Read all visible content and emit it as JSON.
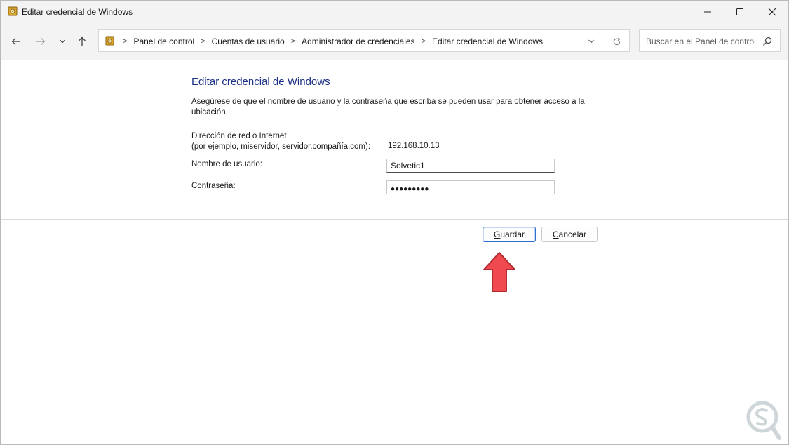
{
  "window": {
    "title": "Editar credencial de Windows",
    "icon": "control-panel-icon"
  },
  "navigation": {
    "breadcrumbs": [
      "Panel de control",
      "Cuentas de usuario",
      "Administrador de credenciales",
      "Editar credencial de Windows"
    ],
    "search_placeholder": "Buscar en el Panel de control"
  },
  "form": {
    "heading": "Editar credencial de Windows",
    "description": "Asegúrese de que el nombre de usuario y la contraseña que escriba se pueden usar para obtener acceso a la ubicación.",
    "address_label_line1": "Dirección de red o Internet",
    "address_label_line2": "(por ejemplo, miservidor, servidor.compañía.com):",
    "address_value": "192.168.10.13",
    "username_label": "Nombre de usuario:",
    "username_value": "Solvetic1",
    "password_label": "Contraseña:",
    "password_mask": "●●●●●●●●●"
  },
  "buttons": {
    "save_prefix": "",
    "save_access_key": "G",
    "save_rest": "uardar",
    "cancel_access_key": "C",
    "cancel_rest": "ancelar"
  },
  "colors": {
    "heading": "#1e3287",
    "arrow": "#f04a50",
    "default_button_border": "#2f6fd1",
    "chrome": "#f3f3f3"
  }
}
